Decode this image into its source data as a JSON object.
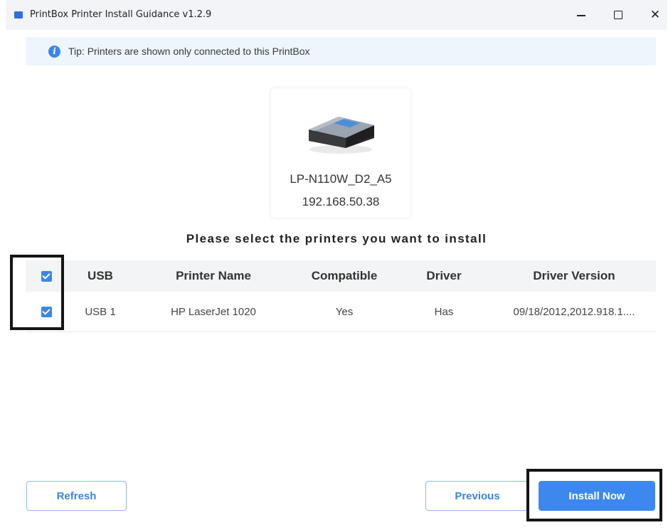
{
  "window": {
    "title": "PrintBox Printer Install Guidance v1.2.9",
    "controls": {
      "minimize_icon": "minimize-icon",
      "maximize_icon": "maximize-icon",
      "close_glyph": "✕"
    }
  },
  "tip": {
    "icon": "info-icon",
    "icon_glyph": "i",
    "text": "Tip:  Printers are shown only connected to this PrintBox"
  },
  "device": {
    "name": "LP-N110W_D2_A5",
    "ip": "192.168.50.38"
  },
  "instruction": "Please select the printers you want to install",
  "table": {
    "headers": {
      "usb": "USB",
      "printer_name": "Printer Name",
      "compatible": "Compatible",
      "driver": "Driver",
      "driver_version": "Driver Version"
    },
    "select_all_checked": true,
    "rows": [
      {
        "checked": true,
        "usb": "USB 1",
        "printer_name": "HP LaserJet 1020",
        "compatible": "Yes",
        "driver": "Has",
        "driver_version": "09/18/2012,2012.918.1...."
      }
    ]
  },
  "buttons": {
    "refresh": "Refresh",
    "previous": "Previous",
    "install_now": "Install Now"
  },
  "colors": {
    "accent": "#3d88ef",
    "tip_background": "#eef5fd",
    "titlebar_background": "#f2f4f8",
    "table_header_background": "#f3f4f6"
  }
}
